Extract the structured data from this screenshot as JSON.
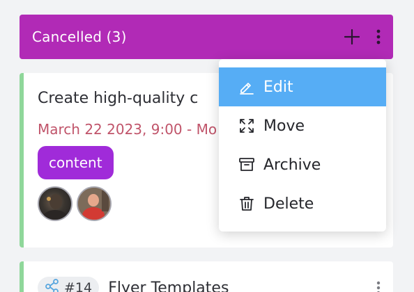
{
  "column": {
    "title": "Cancelled (3)",
    "header_color": "#b12ab6",
    "add_icon": "plus-icon",
    "more_icon": "vertical-dots-icon"
  },
  "card1": {
    "title": "Create high-quality c",
    "date": "March 22 2023, 9:00 - Mo",
    "tag": "content",
    "tag_color": "#a02bd9",
    "accent_color": "#8fd79a",
    "avatars": [
      "user-avatar-1",
      "user-avatar-2"
    ]
  },
  "card2": {
    "ticket": "#14",
    "title": "Flyer Templates",
    "link_icon": "share-icon"
  },
  "dropdown": {
    "items": [
      {
        "label": "Edit",
        "icon": "pencil-icon",
        "active": true
      },
      {
        "label": "Move",
        "icon": "move-arrows-icon",
        "active": false
      },
      {
        "label": "Archive",
        "icon": "archive-box-icon",
        "active": false
      },
      {
        "label": "Delete",
        "icon": "trash-icon",
        "active": false
      }
    ],
    "active_color": "#56adf5"
  }
}
